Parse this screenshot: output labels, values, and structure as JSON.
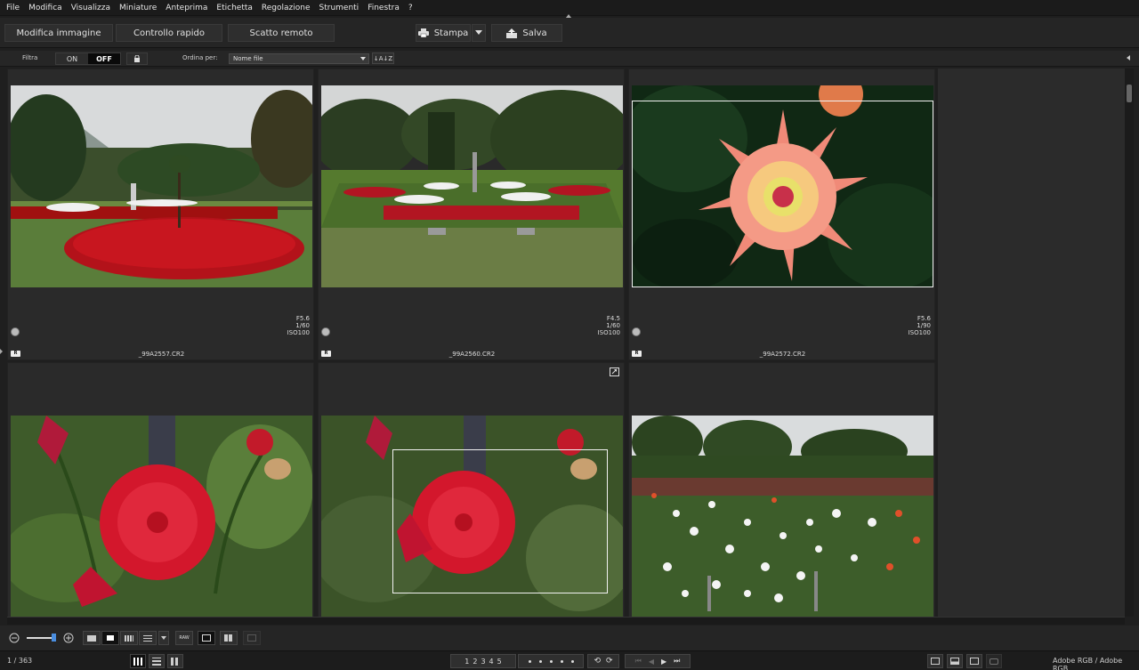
{
  "menu": [
    "File",
    "Modifica",
    "Visualizza",
    "Miniature",
    "Anteprima",
    "Etichetta",
    "Regolazione",
    "Strumenti",
    "Finestra",
    "?"
  ],
  "toolbar": {
    "edit_image": "Modifica immagine",
    "quick_check": "Controllo rapido",
    "remote_shoot": "Scatto remoto",
    "print": "Stampa",
    "save": "Salva"
  },
  "filter": {
    "label": "Filtra",
    "on": "ON",
    "off": "OFF",
    "sort_label": "Ordina per:",
    "sort_value": "Nome file",
    "sort_order_icon": "↓A↓Z"
  },
  "thumbnails": [
    {
      "file": "_99A2557.CR2",
      "aperture": "F5.6",
      "shutter": "1/60",
      "iso": "ISO100",
      "badge": "R"
    },
    {
      "file": "_99A2560.CR2",
      "aperture": "F4.5",
      "shutter": "1/60",
      "iso": "ISO100",
      "badge": "R"
    },
    {
      "file": "_99A2572.CR2",
      "aperture": "F5.6",
      "shutter": "1/90",
      "iso": "ISO100",
      "badge": "R"
    }
  ],
  "status": {
    "count": "1 / 363",
    "rating_buttons": [
      "1",
      "2",
      "3",
      "4",
      "5"
    ],
    "color_space": "Adobe RGB / Adobe RGB",
    "raw_label": "RAW"
  },
  "icons": {
    "zoom_out": "minus-circle-icon",
    "zoom_in": "plus-circle-icon",
    "print": "printer-icon",
    "save": "save-icon",
    "lock": "lock-icon",
    "edit_corner": "edit-corner-icon",
    "rating": "rating-disc-icon"
  },
  "colors": {
    "background": "#1f1f1f",
    "cell": "#2a2a2a",
    "toolbar": "#252525",
    "selection": "#f2f2f2"
  }
}
